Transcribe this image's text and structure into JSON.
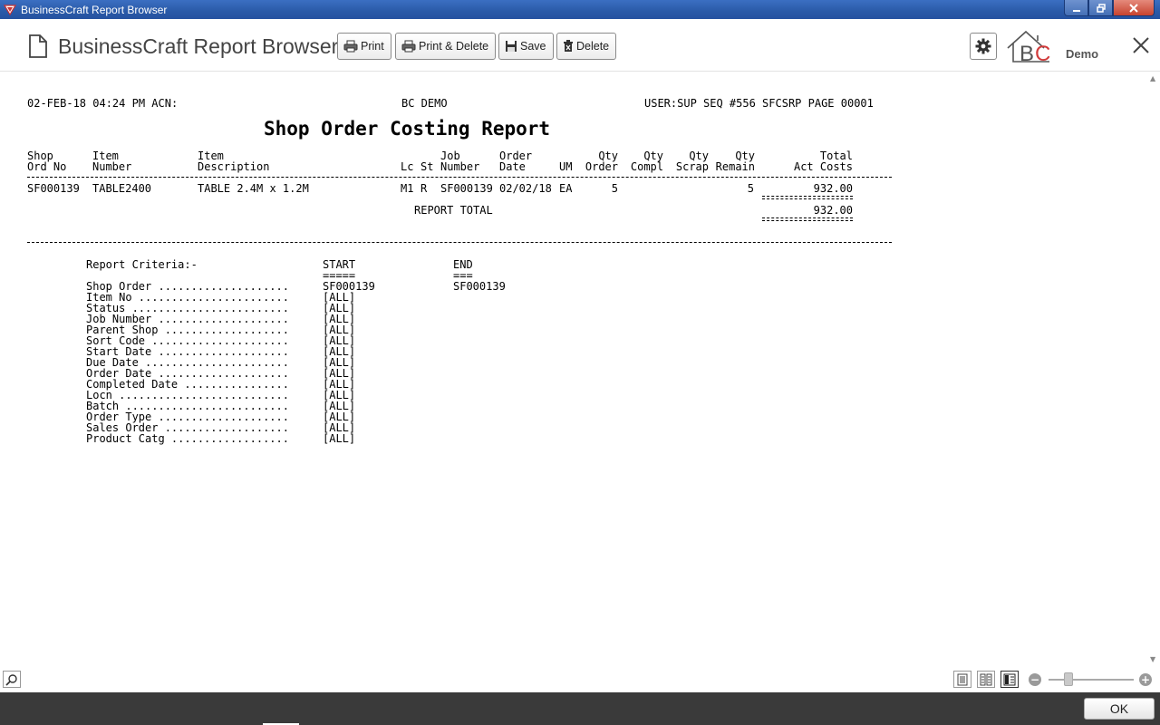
{
  "window": {
    "title": "BusinessCraft Report Browser"
  },
  "toolbar": {
    "title": "BusinessCraft Report Browser",
    "print_label": "Print",
    "print_delete_label": "Print & Delete",
    "save_label": "Save",
    "delete_label": "Delete",
    "logo_text": "BC",
    "company_label": "Demo"
  },
  "report": {
    "header_left": "02-FEB-18 04:24 PM ACN:",
    "header_center": "BC DEMO",
    "header_right": "USER:SUP SEQ #556 SFCSRP PAGE 00001",
    "title": "Shop Order Costing Report",
    "columns": [
      {
        "line1": "Shop",
        "line2": "Ord No"
      },
      {
        "line1": "Item",
        "line2": "Number"
      },
      {
        "line1": "Item",
        "line2": "Description"
      },
      {
        "line1": "",
        "line2": "Lc"
      },
      {
        "line1": "",
        "line2": "St"
      },
      {
        "line1": "Job",
        "line2": "Number"
      },
      {
        "line1": "Order",
        "line2": "Date"
      },
      {
        "line1": "",
        "line2": "UM"
      },
      {
        "line1": "Qty",
        "line2": "Order"
      },
      {
        "line1": "Qty",
        "line2": "Compl"
      },
      {
        "line1": "Qty",
        "line2": "Scrap"
      },
      {
        "line1": "Qty",
        "line2": "Remain"
      },
      {
        "line1": "Total",
        "line2": "Act Costs"
      }
    ],
    "rows": [
      {
        "shop_ord_no": "SF000139",
        "item_number": "TABLE2400",
        "item_description": "TABLE 2.4M x 1.2M",
        "lc": "M1",
        "st": "R",
        "job_number": "SF000139",
        "order_date": "02/02/18",
        "um": "EA",
        "qty_order": "5",
        "qty_compl": "",
        "qty_scrap": "",
        "qty_remain": "5",
        "total_act_costs": "932.00"
      }
    ],
    "total_label": "REPORT TOTAL",
    "total_value": "932.00",
    "criteria": {
      "heading": "Report Criteria:-",
      "start_label": "START",
      "start_underline": "=====",
      "end_label": "END",
      "end_underline": "===",
      "items": [
        {
          "label": "Shop Order ....................",
          "start": "SF000139",
          "end": "SF000139"
        },
        {
          "label": "Item No .......................",
          "start": "[ALL]",
          "end": ""
        },
        {
          "label": "Status ........................",
          "start": "[ALL]",
          "end": ""
        },
        {
          "label": "Job Number ....................",
          "start": "[ALL]",
          "end": ""
        },
        {
          "label": "Parent Shop ...................",
          "start": "[ALL]",
          "end": ""
        },
        {
          "label": "Sort Code .....................",
          "start": "[ALL]",
          "end": ""
        },
        {
          "label": "Start Date ....................",
          "start": "[ALL]",
          "end": ""
        },
        {
          "label": "Due Date ......................",
          "start": "[ALL]",
          "end": ""
        },
        {
          "label": "Order Date ....................",
          "start": "[ALL]",
          "end": ""
        },
        {
          "label": "Completed Date ................",
          "start": "[ALL]",
          "end": ""
        },
        {
          "label": "Locn ..........................",
          "start": "[ALL]",
          "end": ""
        },
        {
          "label": "Batch .........................",
          "start": "[ALL]",
          "end": ""
        },
        {
          "label": "Order Type ....................",
          "start": "[ALL]",
          "end": ""
        },
        {
          "label": "Sales Order ...................",
          "start": "[ALL]",
          "end": ""
        },
        {
          "label": "Product Catg ..................",
          "start": "[ALL]",
          "end": ""
        }
      ]
    }
  },
  "footer": {
    "ok_label": "OK",
    "zoom_minus": "−",
    "zoom_plus": "+",
    "zoom_level": 0.2
  },
  "colors": {
    "titlebar": "#2a5aa8",
    "statusbar": "#3a3a3a",
    "logo_red": "#d23b3b"
  },
  "icons": [
    "app-icon",
    "document-icon",
    "printer-icon",
    "save-icon",
    "delete-icon",
    "gear-icon",
    "bc-logo-icon",
    "close-icon",
    "search-icon",
    "single-page-icon",
    "two-page-icon",
    "continuous-page-icon"
  ]
}
